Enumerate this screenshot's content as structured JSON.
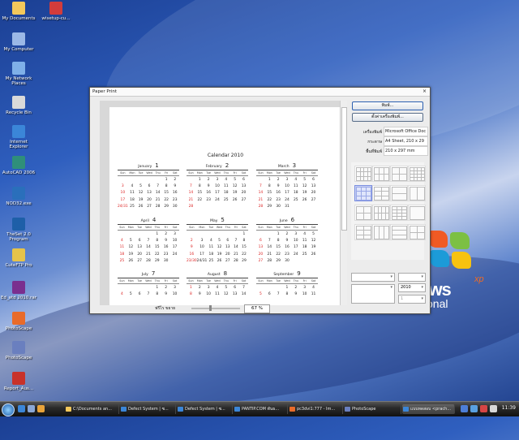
{
  "desktop": {
    "icons": [
      {
        "label": "My Documents",
        "icon": "folder-documents-icon",
        "color": "#f3c85b"
      },
      {
        "label": "wisetup-cu...",
        "icon": "installer-icon",
        "color": "#d23c3c"
      },
      {
        "label": "My Computer",
        "icon": "computer-icon",
        "color": "#9bb8e6"
      },
      {
        "label": "My Network Places",
        "icon": "network-icon",
        "color": "#7fb0e8"
      },
      {
        "label": "Recycle Bin",
        "icon": "recycle-bin-icon",
        "color": "#d9d9d9"
      },
      {
        "label": "Internet Explorer",
        "icon": "ie-icon",
        "color": "#3b86d8"
      },
      {
        "label": "AutoCAD 2006",
        "icon": "autocad-icon",
        "color": "#2f8f7a"
      },
      {
        "label": "NOD32.exe",
        "icon": "nod32-icon",
        "color": "#2a6fbb"
      },
      {
        "label": "TheSet 2.0 Program",
        "icon": "theset-icon",
        "color": "#1e5fa8"
      },
      {
        "label": "CuteFTP Pro",
        "icon": "cuteftp-icon",
        "color": "#e6c34a"
      },
      {
        "label": "Ed_atd 2010.rar",
        "icon": "rar-archive-icon",
        "color": "#7a2f8f"
      },
      {
        "label": "PhotoScape",
        "icon": "photoscape-icon",
        "color": "#e86b2a"
      },
      {
        "label": "PhotoScape",
        "icon": "photoscape-shortcut-icon",
        "color": "#6a7fbf"
      },
      {
        "label": "Report_Aus...",
        "icon": "pdf-icon",
        "color": "#c8322a"
      }
    ],
    "windows_logo": {
      "text": "ows",
      "sup": "xp",
      "edition": "onal"
    }
  },
  "dialog": {
    "title": "Paper Print",
    "close": "×",
    "calendar_title": "Calendar  2010",
    "weekdays": [
      "Sun",
      "Mon",
      "Tue",
      "Wed",
      "Thu",
      "Fri",
      "Sat"
    ],
    "months": [
      {
        "name": "January",
        "num": "1",
        "weeks": [
          [
            "",
            "",
            "",
            "",
            "",
            "1",
            "2"
          ],
          [
            "3",
            "4",
            "5",
            "6",
            "7",
            "8",
            "9"
          ],
          [
            "10",
            "11",
            "12",
            "13",
            "14",
            "15",
            "16"
          ],
          [
            "17",
            "18",
            "19",
            "20",
            "21",
            "22",
            "23"
          ],
          [
            "24/31",
            "25",
            "26",
            "27",
            "28",
            "29",
            "30"
          ]
        ]
      },
      {
        "name": "February",
        "num": "2",
        "weeks": [
          [
            "",
            "1",
            "2",
            "3",
            "4",
            "5",
            "6"
          ],
          [
            "7",
            "8",
            "9",
            "10",
            "11",
            "12",
            "13"
          ],
          [
            "14",
            "15",
            "16",
            "17",
            "18",
            "19",
            "20"
          ],
          [
            "21",
            "22",
            "23",
            "24",
            "25",
            "26",
            "27"
          ],
          [
            "28",
            "",
            "",
            "",
            "",
            "",
            ""
          ]
        ]
      },
      {
        "name": "March",
        "num": "3",
        "weeks": [
          [
            "",
            "1",
            "2",
            "3",
            "4",
            "5",
            "6"
          ],
          [
            "7",
            "8",
            "9",
            "10",
            "11",
            "12",
            "13"
          ],
          [
            "14",
            "15",
            "16",
            "17",
            "18",
            "19",
            "20"
          ],
          [
            "21",
            "22",
            "23",
            "24",
            "25",
            "26",
            "27"
          ],
          [
            "28",
            "29",
            "30",
            "31",
            "",
            "",
            ""
          ]
        ]
      },
      {
        "name": "April",
        "num": "4",
        "weeks": [
          [
            "",
            "",
            "",
            "",
            "1",
            "2",
            "3"
          ],
          [
            "4",
            "5",
            "6",
            "7",
            "8",
            "9",
            "10"
          ],
          [
            "11",
            "12",
            "13",
            "14",
            "15",
            "16",
            "17"
          ],
          [
            "18",
            "19",
            "20",
            "21",
            "22",
            "23",
            "24"
          ],
          [
            "25",
            "26",
            "27",
            "28",
            "29",
            "30",
            ""
          ]
        ]
      },
      {
        "name": "May",
        "num": "5",
        "weeks": [
          [
            "",
            "",
            "",
            "",
            "",
            "",
            "1"
          ],
          [
            "2",
            "3",
            "4",
            "5",
            "6",
            "7",
            "8"
          ],
          [
            "9",
            "10",
            "11",
            "12",
            "13",
            "14",
            "15"
          ],
          [
            "16",
            "17",
            "18",
            "19",
            "20",
            "21",
            "22"
          ],
          [
            "23/30",
            "24/31",
            "25",
            "26",
            "27",
            "28",
            "29"
          ]
        ]
      },
      {
        "name": "June",
        "num": "6",
        "weeks": [
          [
            "",
            "",
            "1",
            "2",
            "3",
            "4",
            "5"
          ],
          [
            "6",
            "7",
            "8",
            "9",
            "10",
            "11",
            "12"
          ],
          [
            "13",
            "14",
            "15",
            "16",
            "17",
            "18",
            "19"
          ],
          [
            "20",
            "21",
            "22",
            "23",
            "24",
            "25",
            "26"
          ],
          [
            "27",
            "28",
            "29",
            "30",
            "",
            "",
            ""
          ]
        ]
      },
      {
        "name": "July",
        "num": "7",
        "weeks": [
          [
            "",
            "",
            "",
            "",
            "1",
            "2",
            "3"
          ],
          [
            "4",
            "5",
            "6",
            "7",
            "8",
            "9",
            "10"
          ]
        ]
      },
      {
        "name": "August",
        "num": "8",
        "weeks": [
          [
            "1",
            "2",
            "3",
            "4",
            "5",
            "6",
            "7"
          ],
          [
            "8",
            "9",
            "10",
            "11",
            "12",
            "13",
            "14"
          ]
        ]
      },
      {
        "name": "September",
        "num": "9",
        "weeks": [
          [
            "",
            "",
            "",
            "1",
            "2",
            "3",
            "4"
          ],
          [
            "5",
            "6",
            "7",
            "8",
            "9",
            "10",
            "11"
          ]
        ]
      }
    ],
    "zoom_label": "ฟรีไร ขยาย",
    "zoom_value": "67 %",
    "print_button": "พิมพ์...",
    "printer_setup_button": "ตั้งค่าเครื่องพิมพ์...",
    "printer_label": "เครื่องพิมพ์",
    "printer_value": "Microsoft Office Doc",
    "paper_label": "กระดาษ",
    "paper_value": "A4 Sheet, 210 x 29",
    "print_area_label": "พื้นที่พิมพ์",
    "print_area_value": "210 x 297 mm",
    "year_value": "2010",
    "month_value": "1"
  },
  "taskbar": {
    "tasks": [
      "C:\\Documents an...",
      "Defect System | ซ...",
      "Defect System | ซ...",
      "PANTIP.COM พันธ...",
      "pc3dvi1:777 - Im...",
      "PhotoScape",
      "แบบทดสอบ <prach..."
    ],
    "clock": "11:39"
  }
}
